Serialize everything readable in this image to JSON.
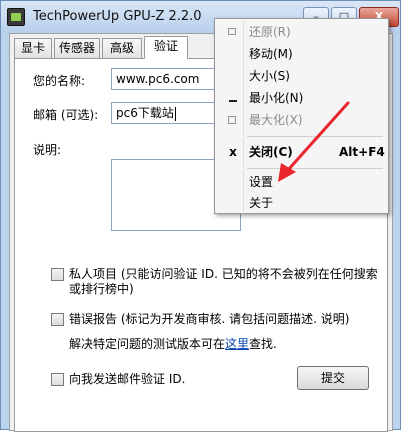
{
  "window": {
    "title": "TechPowerUp GPU-Z 2.2.0",
    "minimize_glyph": "–",
    "maximize_glyph": "□",
    "close_glyph": "X"
  },
  "tabs": [
    {
      "label": "显卡"
    },
    {
      "label": "传感器"
    },
    {
      "label": "高级"
    },
    {
      "label": "验证"
    }
  ],
  "form": {
    "name_label": "您的名称:",
    "name_value": "www.pc6.com",
    "email_label": "邮箱 (可选):",
    "email_value": "pc6下载站",
    "desc_label": "说明:",
    "private_label": "私人项目 (只能访问验证 ID. 已知的将不会被列在任何搜索或排行榜中)",
    "bug_label": "错误报告 (标记为开发商审核. 请包括问题描述. 说明)",
    "note_prefix": "解决特定问题的测试版本可在",
    "note_link": "这里",
    "note_suffix": "查找.",
    "email_me_label": "向我发送邮件验证 ID.",
    "submit_label": "提交"
  },
  "system_menu": {
    "items": [
      {
        "label": "还原(R)",
        "icon": "restore-icon",
        "shortcut": "",
        "disabled": true
      },
      {
        "label": "移动(M)",
        "icon": "",
        "shortcut": "",
        "disabled": false
      },
      {
        "label": "大小(S)",
        "icon": "",
        "shortcut": "",
        "disabled": false
      },
      {
        "label": "最小化(N)",
        "icon": "minimize-icon",
        "shortcut": "",
        "disabled": false
      },
      {
        "label": "最大化(X)",
        "icon": "maximize-icon",
        "shortcut": "",
        "disabled": true
      },
      {
        "label": "关闭(C)",
        "icon": "close-icon",
        "icon_glyph": "x",
        "shortcut": "Alt+F4",
        "disabled": false
      },
      {
        "label": "设置",
        "icon": "",
        "shortcut": "",
        "disabled": false
      },
      {
        "label": "关于",
        "icon": "",
        "shortcut": "",
        "disabled": false
      }
    ]
  },
  "colors": {
    "annotation_arrow": "#e8262c",
    "link": "#0645ad",
    "titlebar": "#c3d7ef"
  }
}
